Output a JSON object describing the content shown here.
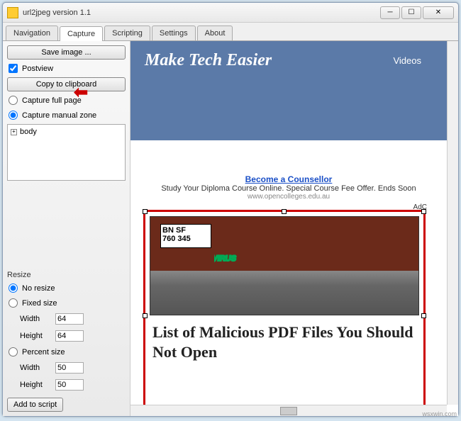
{
  "window": {
    "title": "url2jpeg version 1.1"
  },
  "tabs": [
    "Navigation",
    "Capture",
    "Scripting",
    "Settings",
    "About"
  ],
  "active_tab": 1,
  "sidebar": {
    "save_image": "Save image ...",
    "postview": "Postview",
    "copy_clipboard": "Copy to clipboard",
    "capture_full": "Capture full page",
    "capture_manual": "Capture manual zone",
    "tree_root": "body",
    "resize_label": "Resize",
    "no_resize": "No resize",
    "fixed_size": "Fixed size",
    "width_label": "Width",
    "height_label": "Height",
    "fixed_width": "64",
    "fixed_height": "64",
    "percent_size": "Percent size",
    "percent_width": "50",
    "percent_height": "50",
    "add_script": "Add to script"
  },
  "preview": {
    "hero_title": "Make Tech Easier",
    "hero_link": "Videos",
    "ad_title": "Become a Counsellor",
    "ad_sub": "Study Your Diploma Course Online. Special Course Fee Offer. Ends Soon",
    "ad_url": "www.opencolleges.edu.au",
    "ad_tag": "AdC",
    "bnsf_line1": "BN SF",
    "bnsf_line2": "760 345",
    "article_title": "List of Malicious PDF Files You Should Not Open"
  },
  "watermark": "wsxwin.com"
}
